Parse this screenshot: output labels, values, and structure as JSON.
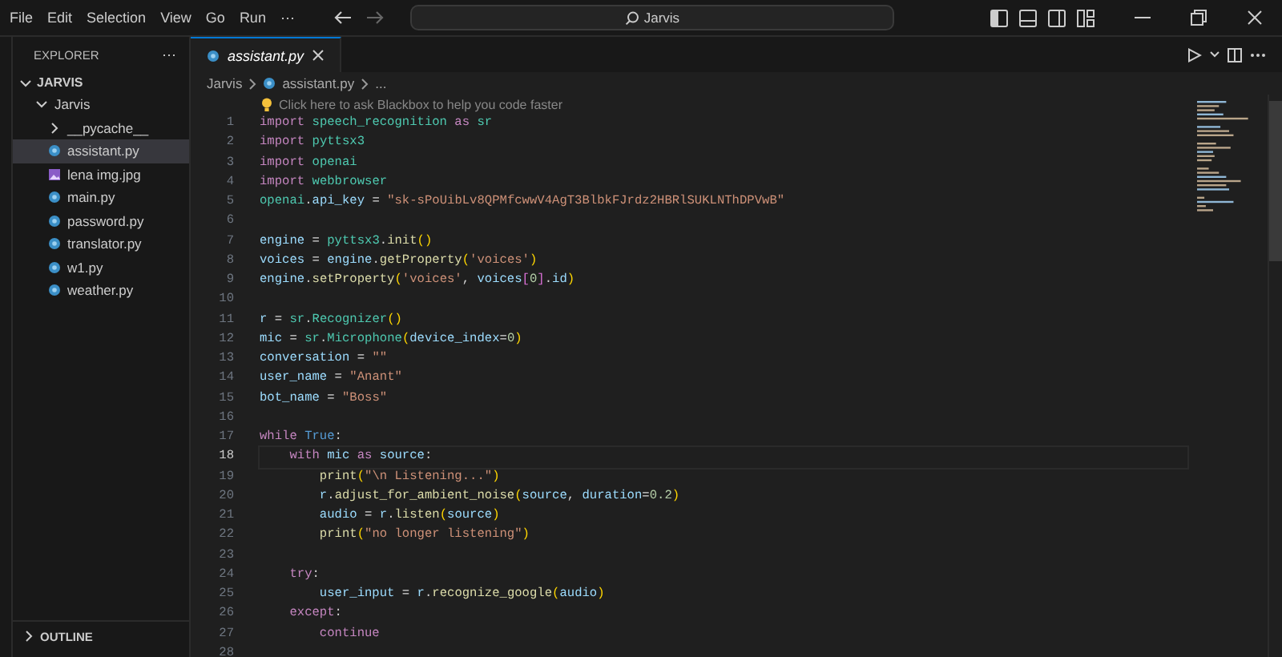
{
  "menu": [
    "File",
    "Edit",
    "Selection",
    "View",
    "Go",
    "Run",
    "⋯"
  ],
  "search": {
    "value": "Jarvis"
  },
  "sidebar": {
    "title": "EXPLORER",
    "more": "⋯",
    "root": {
      "label": "JARVIS",
      "expanded": true
    },
    "tree": [
      {
        "label": "Jarvis",
        "kind": "folder",
        "expanded": true,
        "selected": false,
        "children": [
          {
            "label": "__pycache__",
            "kind": "folder",
            "expanded": false,
            "selected": false
          },
          {
            "label": "assistant.py",
            "kind": "python",
            "selected": true
          },
          {
            "label": "lena img.jpg",
            "kind": "image",
            "selected": false
          },
          {
            "label": "main.py",
            "kind": "python",
            "selected": false
          },
          {
            "label": "password.py",
            "kind": "python",
            "selected": false
          },
          {
            "label": "translator.py",
            "kind": "python",
            "selected": false
          },
          {
            "label": "w1.py",
            "kind": "python",
            "selected": false
          },
          {
            "label": "weather.py",
            "kind": "python",
            "selected": false
          }
        ]
      }
    ],
    "outline": {
      "label": "OUTLINE",
      "expanded": false
    }
  },
  "tabs": [
    {
      "label": "assistant.py",
      "selected": true
    }
  ],
  "breadcrumb": [
    "Jarvis",
    "assistant.py",
    "..."
  ],
  "hint": "Click here to ask Blackbox to help you code faster",
  "lines": [
    {
      "n": "1",
      "current": false,
      "tokens": [
        {
          "text": "import ",
          "kind": "kw"
        },
        {
          "text": "speech_recognition ",
          "kind": "cls"
        },
        {
          "text": "as ",
          "kind": "kw"
        },
        {
          "text": "sr",
          "kind": "cls"
        }
      ]
    },
    {
      "n": "2",
      "current": false,
      "tokens": [
        {
          "text": "import ",
          "kind": "kw"
        },
        {
          "text": "pyttsx3",
          "kind": "cls"
        }
      ]
    },
    {
      "n": "3",
      "current": false,
      "tokens": [
        {
          "text": "import ",
          "kind": "kw"
        },
        {
          "text": "openai",
          "kind": "cls"
        }
      ]
    },
    {
      "n": "4",
      "current": false,
      "tokens": [
        {
          "text": "import ",
          "kind": "kw"
        },
        {
          "text": "webbrowser",
          "kind": "cls"
        }
      ]
    },
    {
      "n": "5",
      "current": false,
      "tokens": [
        {
          "text": "openai",
          "kind": "cls"
        },
        {
          "text": ".",
          "kind": "plain"
        },
        {
          "text": "api_key",
          "kind": "var"
        },
        {
          "text": " = ",
          "kind": "plain"
        },
        {
          "text": "\"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\"",
          "kind": "str"
        }
      ]
    },
    {
      "n": "6",
      "current": false
    },
    {
      "n": "7",
      "current": false,
      "tokens": [
        {
          "text": "engine",
          "kind": "var"
        },
        {
          "text": " = ",
          "kind": "plain"
        },
        {
          "text": "pyttsx3",
          "kind": "cls"
        },
        {
          "text": ".",
          "kind": "plain"
        },
        {
          "text": "init",
          "kind": "fn"
        },
        {
          "text": "()",
          "kind": "br"
        }
      ]
    },
    {
      "n": "8",
      "current": false,
      "tokens": [
        {
          "text": "voices",
          "kind": "var"
        },
        {
          "text": " = ",
          "kind": "plain"
        },
        {
          "text": "engine",
          "kind": "var"
        },
        {
          "text": ".",
          "kind": "plain"
        },
        {
          "text": "getProperty",
          "kind": "fn"
        },
        {
          "text": "(",
          "kind": "br"
        },
        {
          "text": "'voices'",
          "kind": "str"
        },
        {
          "text": ")",
          "kind": "br"
        }
      ]
    },
    {
      "n": "9",
      "current": false,
      "tokens": [
        {
          "text": "engine",
          "kind": "var"
        },
        {
          "text": ".",
          "kind": "plain"
        },
        {
          "text": "setProperty",
          "kind": "fn"
        },
        {
          "text": "(",
          "kind": "br"
        },
        {
          "text": "'voices'",
          "kind": "str"
        },
        {
          "text": ", ",
          "kind": "plain"
        },
        {
          "text": "voices",
          "kind": "var"
        },
        {
          "text": "[",
          "kind": "br2"
        },
        {
          "text": "0",
          "kind": "num"
        },
        {
          "text": "]",
          "kind": "br2"
        },
        {
          "text": ".",
          "kind": "plain"
        },
        {
          "text": "id",
          "kind": "var"
        },
        {
          "text": ")",
          "kind": "br"
        }
      ]
    },
    {
      "n": "10",
      "current": false
    },
    {
      "n": "11",
      "current": false,
      "tokens": [
        {
          "text": "r",
          "kind": "var"
        },
        {
          "text": " = ",
          "kind": "plain"
        },
        {
          "text": "sr",
          "kind": "cls"
        },
        {
          "text": ".",
          "kind": "plain"
        },
        {
          "text": "Recognizer",
          "kind": "cls"
        },
        {
          "text": "()",
          "kind": "br"
        }
      ]
    },
    {
      "n": "12",
      "current": false,
      "tokens": [
        {
          "text": "mic",
          "kind": "var"
        },
        {
          "text": " = ",
          "kind": "plain"
        },
        {
          "text": "sr",
          "kind": "cls"
        },
        {
          "text": ".",
          "kind": "plain"
        },
        {
          "text": "Microphone",
          "kind": "cls"
        },
        {
          "text": "(",
          "kind": "br"
        },
        {
          "text": "device_index",
          "kind": "var"
        },
        {
          "text": "=",
          "kind": "plain"
        },
        {
          "text": "0",
          "kind": "num"
        },
        {
          "text": ")",
          "kind": "br"
        }
      ]
    },
    {
      "n": "13",
      "current": false,
      "tokens": [
        {
          "text": "conversation",
          "kind": "var"
        },
        {
          "text": " = ",
          "kind": "plain"
        },
        {
          "text": "\"\"",
          "kind": "str"
        }
      ]
    },
    {
      "n": "14",
      "current": false,
      "tokens": [
        {
          "text": "user_name",
          "kind": "var"
        },
        {
          "text": " = ",
          "kind": "plain"
        },
        {
          "text": "\"Anant\"",
          "kind": "str"
        }
      ]
    },
    {
      "n": "15",
      "current": false,
      "tokens": [
        {
          "text": "bot_name",
          "kind": "var"
        },
        {
          "text": " = ",
          "kind": "plain"
        },
        {
          "text": "\"Boss\"",
          "kind": "str"
        }
      ]
    },
    {
      "n": "16",
      "current": false
    },
    {
      "n": "17",
      "current": false,
      "tokens": [
        {
          "text": "while ",
          "kind": "kw"
        },
        {
          "text": "True",
          "kind": "const"
        },
        {
          "text": ":",
          "kind": "plain"
        }
      ]
    },
    {
      "n": "18",
      "current": true,
      "tokens": [
        {
          "text": "    with ",
          "kind": "kw"
        },
        {
          "text": "mic ",
          "kind": "var"
        },
        {
          "text": "as ",
          "kind": "kw"
        },
        {
          "text": "source",
          "kind": "var"
        },
        {
          "text": ":",
          "kind": "plain"
        }
      ]
    },
    {
      "n": "19",
      "current": false,
      "tokens": [
        {
          "text": "        print",
          "kind": "fn"
        },
        {
          "text": "(",
          "kind": "br"
        },
        {
          "text": "\"\\n Listening...\"",
          "kind": "str"
        },
        {
          "text": ")",
          "kind": "br"
        }
      ]
    },
    {
      "n": "20",
      "current": false,
      "tokens": [
        {
          "text": "        r",
          "kind": "var"
        },
        {
          "text": ".",
          "kind": "plain"
        },
        {
          "text": "adjust_for_ambient_noise",
          "kind": "fn"
        },
        {
          "text": "(",
          "kind": "br"
        },
        {
          "text": "source",
          "kind": "var"
        },
        {
          "text": ", ",
          "kind": "plain"
        },
        {
          "text": "duration",
          "kind": "var"
        },
        {
          "text": "=",
          "kind": "plain"
        },
        {
          "text": "0.2",
          "kind": "num"
        },
        {
          "text": ")",
          "kind": "br"
        }
      ]
    },
    {
      "n": "21",
      "current": false,
      "tokens": [
        {
          "text": "        audio",
          "kind": "var"
        },
        {
          "text": " = ",
          "kind": "plain"
        },
        {
          "text": "r",
          "kind": "var"
        },
        {
          "text": ".",
          "kind": "plain"
        },
        {
          "text": "listen",
          "kind": "fn"
        },
        {
          "text": "(",
          "kind": "br"
        },
        {
          "text": "source",
          "kind": "var"
        },
        {
          "text": ")",
          "kind": "br"
        }
      ]
    },
    {
      "n": "22",
      "current": false,
      "tokens": [
        {
          "text": "        print",
          "kind": "fn"
        },
        {
          "text": "(",
          "kind": "br"
        },
        {
          "text": "\"no longer listening\"",
          "kind": "str"
        },
        {
          "text": ")",
          "kind": "br"
        }
      ]
    },
    {
      "n": "23",
      "current": false
    },
    {
      "n": "24",
      "current": false,
      "tokens": [
        {
          "text": "    try",
          "kind": "kw"
        },
        {
          "text": ":",
          "kind": "plain"
        }
      ]
    },
    {
      "n": "25",
      "current": false,
      "tokens": [
        {
          "text": "        user_input",
          "kind": "var"
        },
        {
          "text": " = ",
          "kind": "plain"
        },
        {
          "text": "r",
          "kind": "var"
        },
        {
          "text": ".",
          "kind": "plain"
        },
        {
          "text": "recognize_google",
          "kind": "fn"
        },
        {
          "text": "(",
          "kind": "br"
        },
        {
          "text": "audio",
          "kind": "var"
        },
        {
          "text": ")",
          "kind": "br"
        }
      ]
    },
    {
      "n": "26",
      "current": false,
      "tokens": [
        {
          "text": "    except",
          "kind": "kw"
        },
        {
          "text": ":",
          "kind": "plain"
        }
      ]
    },
    {
      "n": "27",
      "current": false,
      "tokens": [
        {
          "text": "        continue",
          "kind": "kw"
        }
      ]
    },
    {
      "n": "28",
      "current": false
    }
  ]
}
